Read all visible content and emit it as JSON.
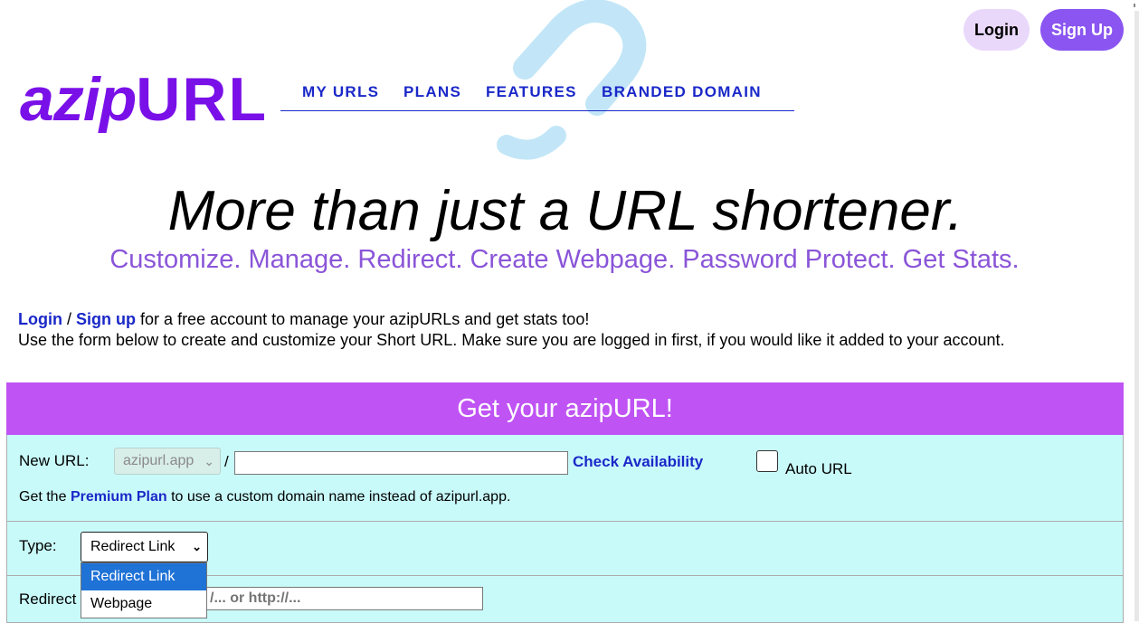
{
  "header": {
    "logo_left": "azip",
    "logo_right": "URL",
    "nav": [
      "MY URLS",
      "PLANS",
      "FEATURES",
      "BRANDED DOMAIN"
    ],
    "login_label": "Login",
    "signup_label": "Sign Up"
  },
  "hero": {
    "headline": "More than just a URL shortener.",
    "tagline": "Customize. Manage. Redirect. Create Webpage. Password Protect. Get Stats."
  },
  "intro": {
    "login_link": "Login",
    "separator": "/",
    "signup_link": "Sign up",
    "line1_rest": "for a free account to manage your azipURLs and get stats too!",
    "line2": "Use the form below to create and customize your Short URL. Make sure you are logged in first, if you would like it added to your account."
  },
  "form": {
    "title": "Get your azipURL!",
    "new_url_label": "New URL:",
    "domain_value": "azipurl.app",
    "slash": "/",
    "path_value": "",
    "check_label": "Check Availability",
    "auto_url_label": "Auto URL",
    "auto_url_checked": false,
    "premium_prefix": "Get the",
    "premium_link": "Premium Plan",
    "premium_suffix": "to use a custom domain name instead of azipurl.app.",
    "type_label": "Type:",
    "type_value": "Redirect Link",
    "type_options": [
      "Redirect Link",
      "Webpage"
    ],
    "type_highlighted": "Redirect Link",
    "redirect_label": "Redirect",
    "redirect_placeholder_visible": "/... or http://..."
  },
  "colors": {
    "accent_purple": "#bf53f4",
    "link_blue": "#1a28c8",
    "panel_cyan": "#c9fafa",
    "signup_purple": "#8a55f0",
    "login_lavender": "#ead8fb",
    "tagline_purple": "#8a55d8"
  }
}
